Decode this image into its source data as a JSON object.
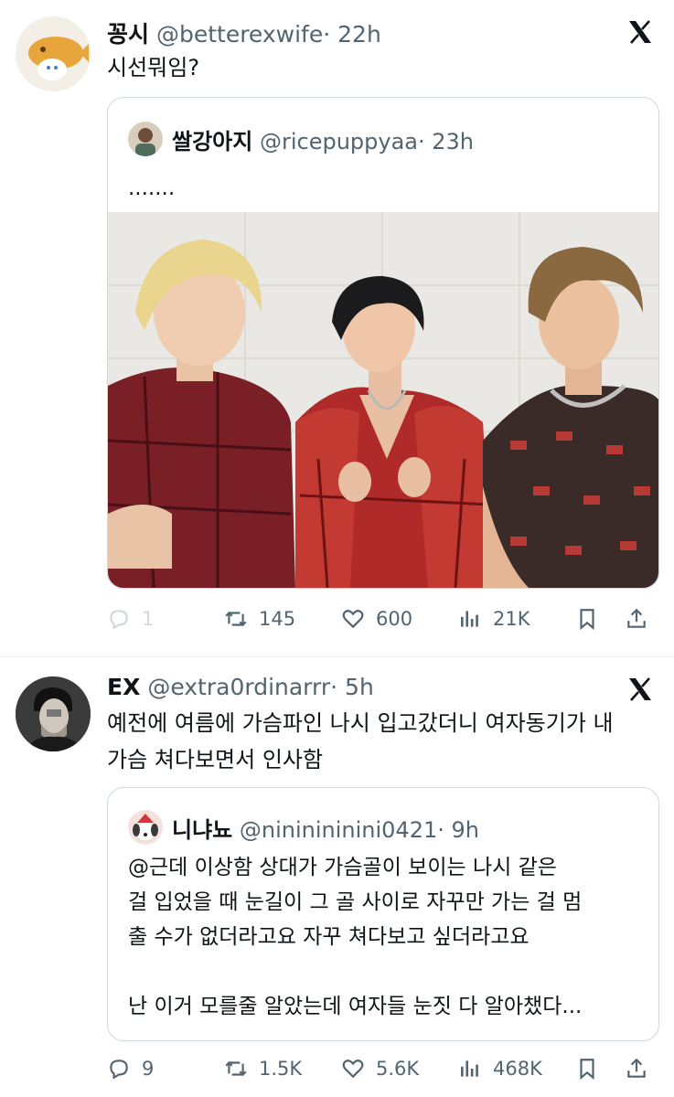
{
  "tweets": [
    {
      "name": "꽁시",
      "handle": "@betterexwife",
      "time": "· 22h",
      "text": "시선뭐임?",
      "quote": {
        "name": "쌀강아지",
        "handle": "@ricepuppyaa",
        "time": "· 23h",
        "text": "......."
      },
      "stats": {
        "replies": "1",
        "retweets": "145",
        "likes": "600",
        "views": "21K"
      }
    },
    {
      "name": "EX",
      "handle": "@extra0rdinarrr",
      "time": "· 5h",
      "text_lines": [
        "예전에 여름에 가슴파인 나시 입고갔더니 여자동기가 내",
        "가슴 쳐다보면서 인사함"
      ],
      "quote": {
        "name": "니냐뇨",
        "handle": "@nininininini0421",
        "time": "· 9h",
        "text_lines": [
          "@근데 이상함 상대가 가슴골이 보이는 나시 같은",
          "걸 입었을 때 눈길이 그 골 사이로 자꾸만 가는 걸 멈",
          "출 수가 없더라고요 자꾸 쳐다보고 싶더라고요",
          "",
          "난 이거 모를줄 알았는데 여자들 눈짓 다 알아챘다..."
        ]
      },
      "stats": {
        "replies": "9",
        "retweets": "1.5K",
        "likes": "5.6K",
        "views": "468K"
      }
    }
  ],
  "icons": [
    "x-logo-icon",
    "reply-icon",
    "retweet-icon",
    "like-icon",
    "views-icon",
    "bookmark-icon",
    "share-icon"
  ],
  "colors": {
    "text": "#0f1419",
    "secondary": "#536471",
    "border": "#cfd9de"
  }
}
